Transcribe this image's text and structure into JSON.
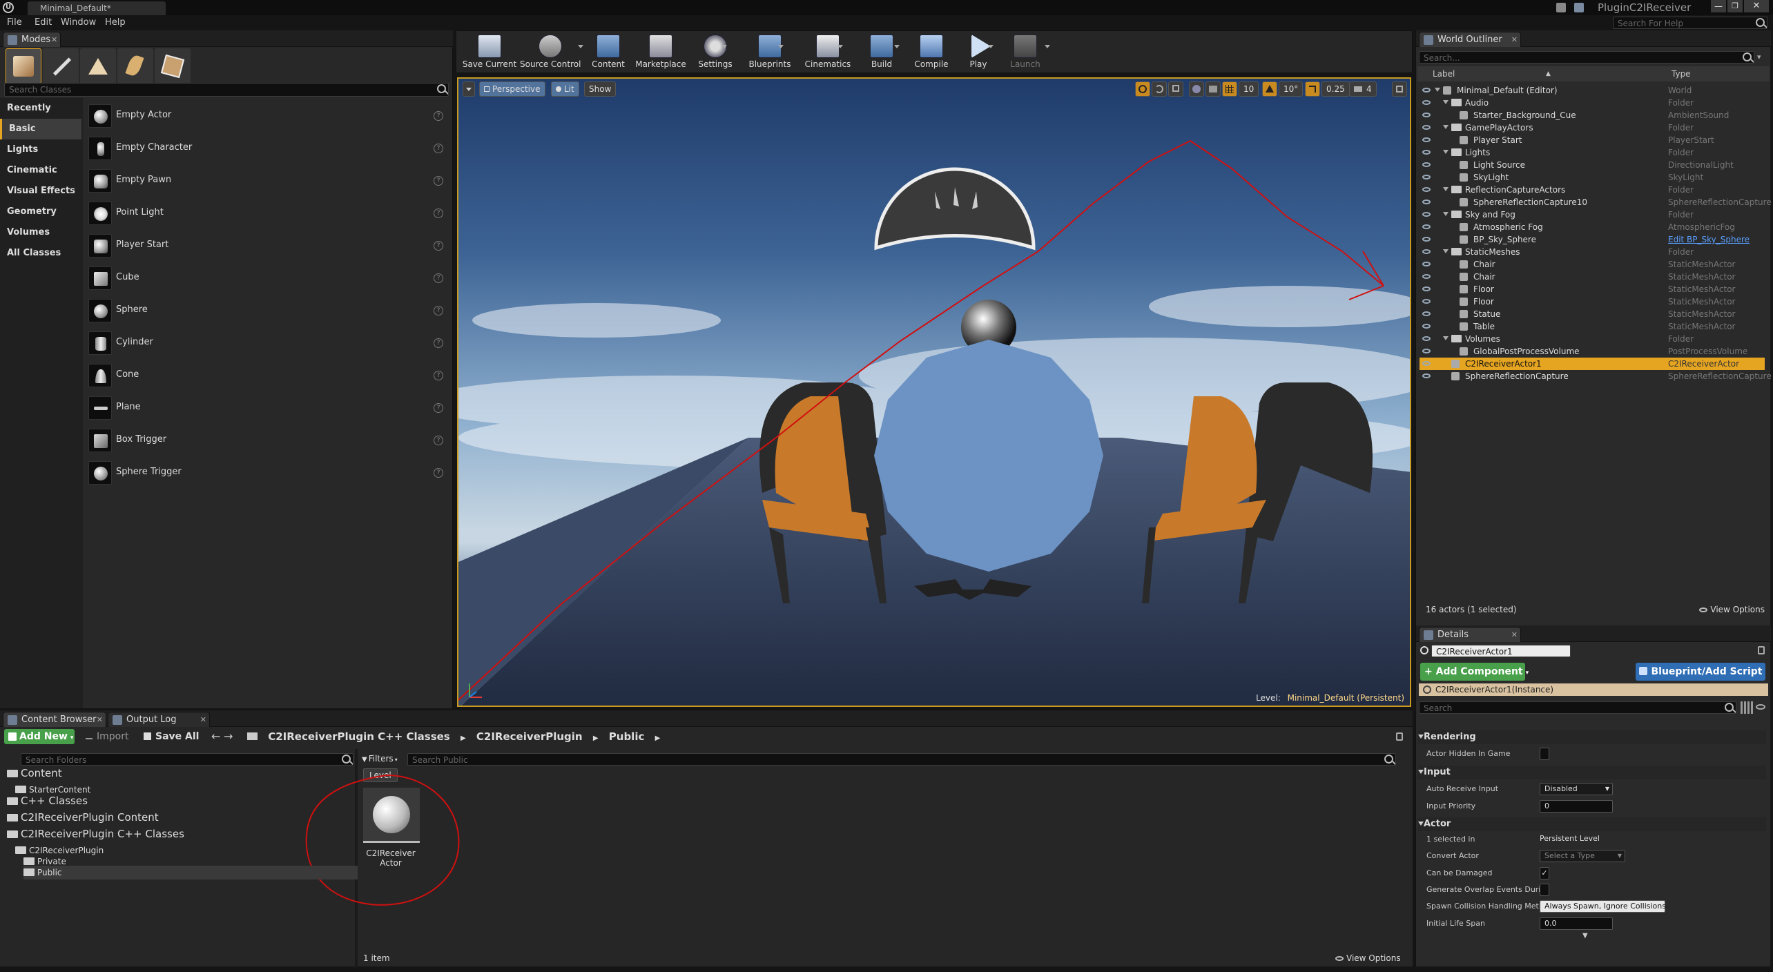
{
  "window": {
    "tab_title": "Minimal_Default*",
    "project_name": "PluginC2IReceiver",
    "help_search_placeholder": "Search For Help"
  },
  "menu": [
    "File",
    "Edit",
    "Window",
    "Help"
  ],
  "modes": {
    "tab": "Modes",
    "search_placeholder": "Search Classes",
    "categories": [
      "Recently Placed",
      "Basic",
      "Lights",
      "Cinematic",
      "Visual Effects",
      "Geometry",
      "Volumes",
      "All Classes"
    ],
    "selected_category": "Basic",
    "items": [
      "Empty Actor",
      "Empty Character",
      "Empty Pawn",
      "Point Light",
      "Player Start",
      "Cube",
      "Sphere",
      "Cylinder",
      "Cone",
      "Plane",
      "Box Trigger",
      "Sphere Trigger"
    ]
  },
  "toolbar": [
    {
      "label": "Save Current",
      "icon": "save-icon"
    },
    {
      "label": "Source Control",
      "icon": "source-control-icon"
    },
    {
      "label": "Content",
      "icon": "content-icon"
    },
    {
      "label": "Marketplace",
      "icon": "marketplace-icon"
    },
    {
      "label": "Settings",
      "icon": "gear-icon"
    },
    {
      "label": "Blueprints",
      "icon": "blueprints-icon"
    },
    {
      "label": "Cinematics",
      "icon": "clapper-icon"
    },
    {
      "label": "Build",
      "icon": "build-icon"
    },
    {
      "label": "Compile",
      "icon": "compile-icon"
    },
    {
      "label": "Play",
      "icon": "play-icon"
    },
    {
      "label": "Launch",
      "icon": "launch-icon"
    }
  ],
  "viewport": {
    "perspective": "Perspective",
    "lit": "Lit",
    "show": "Show",
    "grid_snap": "10",
    "rot_snap": "10°",
    "scale_snap": "0.25",
    "camera_speed": "4",
    "level_label": "Level:",
    "level_name": "Minimal_Default (Persistent)",
    "colors": {
      "sky_top": "#1f3b6a",
      "sky_bottom": "#c7d6e2",
      "floor": "#2a3550",
      "blob": "#6c93c4",
      "chair_seat": "#c87a2a",
      "annotation": "#d01010"
    }
  },
  "outliner": {
    "tab": "World Outliner",
    "search_placeholder": "Search...",
    "col_label": "Label",
    "col_type": "Type",
    "rows": [
      {
        "label": "Minimal_Default (Editor)",
        "type": "World",
        "depth": 0,
        "kind": "world"
      },
      {
        "label": "Audio",
        "type": "Folder",
        "depth": 1,
        "kind": "folder"
      },
      {
        "label": "Starter_Background_Cue",
        "type": "AmbientSound",
        "depth": 2,
        "kind": "actor"
      },
      {
        "label": "GamePlayActors",
        "type": "Folder",
        "depth": 1,
        "kind": "folder"
      },
      {
        "label": "Player Start",
        "type": "PlayerStart",
        "depth": 2,
        "kind": "actor"
      },
      {
        "label": "Lights",
        "type": "Folder",
        "depth": 1,
        "kind": "folder"
      },
      {
        "label": "Light Source",
        "type": "DirectionalLight",
        "depth": 2,
        "kind": "actor"
      },
      {
        "label": "SkyLight",
        "type": "SkyLight",
        "depth": 2,
        "kind": "actor"
      },
      {
        "label": "ReflectionCaptureActors",
        "type": "Folder",
        "depth": 1,
        "kind": "folder"
      },
      {
        "label": "SphereReflectionCapture10",
        "type": "SphereReflectionCapture",
        "depth": 2,
        "kind": "actor"
      },
      {
        "label": "Sky and Fog",
        "type": "Folder",
        "depth": 1,
        "kind": "folder"
      },
      {
        "label": "Atmospheric Fog",
        "type": "AtmosphericFog",
        "depth": 2,
        "kind": "actor"
      },
      {
        "label": "BP_Sky_Sphere",
        "type": "Edit BP_Sky_Sphere",
        "depth": 2,
        "kind": "actor",
        "link": true
      },
      {
        "label": "StaticMeshes",
        "type": "Folder",
        "depth": 1,
        "kind": "folder"
      },
      {
        "label": "Chair",
        "type": "StaticMeshActor",
        "depth": 2,
        "kind": "actor"
      },
      {
        "label": "Chair",
        "type": "StaticMeshActor",
        "depth": 2,
        "kind": "actor"
      },
      {
        "label": "Floor",
        "type": "StaticMeshActor",
        "depth": 2,
        "kind": "actor"
      },
      {
        "label": "Floor",
        "type": "StaticMeshActor",
        "depth": 2,
        "kind": "actor"
      },
      {
        "label": "Statue",
        "type": "StaticMeshActor",
        "depth": 2,
        "kind": "actor"
      },
      {
        "label": "Table",
        "type": "StaticMeshActor",
        "depth": 2,
        "kind": "actor"
      },
      {
        "label": "Volumes",
        "type": "Folder",
        "depth": 1,
        "kind": "folder"
      },
      {
        "label": "GlobalPostProcessVolume",
        "type": "PostProcessVolume",
        "depth": 2,
        "kind": "actor"
      },
      {
        "label": "C2IReceiverActor1",
        "type": "C2IReceiverActor",
        "depth": 1,
        "kind": "actor",
        "selected": true
      },
      {
        "label": "SphereReflectionCapture",
        "type": "SphereReflectionCapture",
        "depth": 1,
        "kind": "actor"
      }
    ],
    "status": "16 actors (1 selected)",
    "view_options": "View Options"
  },
  "details": {
    "tab": "Details",
    "name_value": "C2IReceiverActor1",
    "add_component": "+ Add Component",
    "blueprint_script": "Blueprint/Add Script",
    "instance_label": "C2IReceiverActor1(Instance)",
    "search_placeholder": "Search",
    "sections": {
      "rendering": "Rendering",
      "input": "Input",
      "actor": "Actor"
    },
    "props": {
      "hidden_in_game": "Actor Hidden In Game",
      "auto_receive_input": "Auto Receive Input",
      "auto_receive_input_value": "Disabled",
      "input_priority": "Input Priority",
      "input_priority_value": "0",
      "selected_in": "1 selected in",
      "selected_in_value": "Persistent Level",
      "convert_actor": "Convert Actor",
      "convert_actor_value": "Select a Type",
      "can_be_damaged": "Can be Damaged",
      "overlap_events": "Generate Overlap Events Durin",
      "spawn_collision": "Spawn Collision Handling Meth",
      "spawn_collision_value": "Always Spawn, Ignore Collisions",
      "initial_life_span": "Initial Life Span",
      "initial_life_span_value": "0.0"
    }
  },
  "content_browser": {
    "tabs": [
      "Content Browser",
      "Output Log"
    ],
    "add_new": "Add New",
    "import": "Import",
    "save_all": "Save All",
    "breadcrumb": [
      "C2IReceiverPlugin C++ Classes",
      "C2IReceiverPlugin",
      "Public"
    ],
    "folder_search_placeholder": "Search Folders",
    "filters": "Filters",
    "asset_search_placeholder": "Search Public",
    "filter_chip": "Level",
    "tree": [
      {
        "label": "Content",
        "depth": 0,
        "size": "big"
      },
      {
        "label": "StarterContent",
        "depth": 1,
        "size": "small"
      },
      {
        "label": "C++ Classes",
        "depth": 0,
        "size": "big"
      },
      {
        "label": "C2IReceiverPlugin Content",
        "depth": 0,
        "size": "big"
      },
      {
        "label": "C2IReceiverPlugin C++ Classes",
        "depth": 0,
        "size": "big"
      },
      {
        "label": "C2IReceiverPlugin",
        "depth": 1,
        "size": "small"
      },
      {
        "label": "Private",
        "depth": 2,
        "size": "small"
      },
      {
        "label": "Public",
        "depth": 2,
        "size": "small",
        "selected": true
      }
    ],
    "asset": {
      "line1": "C2IReceiver",
      "line2": "Actor"
    },
    "item_count": "1 item",
    "view_options": "View Options"
  }
}
